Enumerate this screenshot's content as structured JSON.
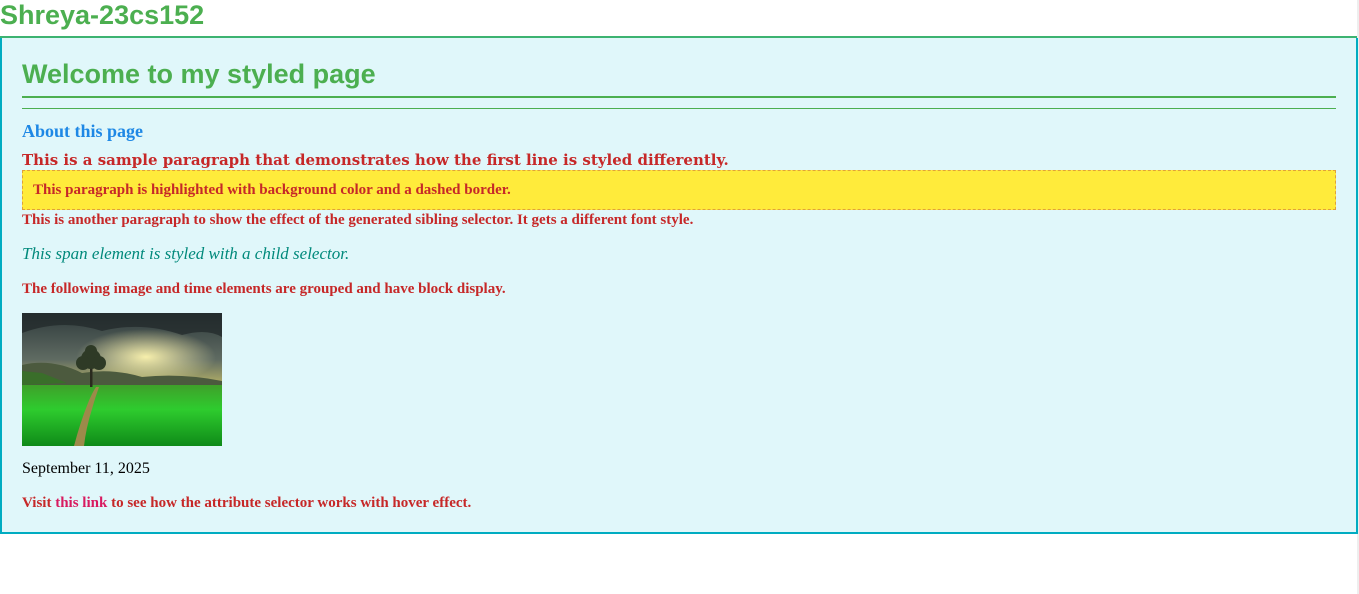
{
  "header": {
    "title": "Shreya-23cs152"
  },
  "main": {
    "heading": "Welcome to my styled page",
    "subheading": "About this page",
    "first_line_paragraph": "This is a sample paragraph that demonstrates how the first line is styled differently.",
    "highlighted_paragraph": "This paragraph is highlighted with background color and a dashed border.",
    "sibling_paragraph": "This is another paragraph to show the effect of the generated sibling selector. It gets a different font style.",
    "child_span": "This span element is styled with a child selector.",
    "grouped_paragraph": "The following image and time elements are grouped and have block display.",
    "image_icon": "landscape-photo",
    "time": "September 11, 2025",
    "link_prefix": "Visit ",
    "link_text": "this link",
    "link_suffix": " to see how the attribute selector works with hover effect."
  },
  "colors": {
    "title_green": "#4caf50",
    "container_border": "#00acc1",
    "container_bg": "#e0f7fa",
    "subheading_blue": "#1e88e5",
    "paragraph_red": "#c62828",
    "highlight_yellow": "#ffeb3b",
    "span_teal": "#00897b",
    "link_pink": "#d81b60"
  }
}
